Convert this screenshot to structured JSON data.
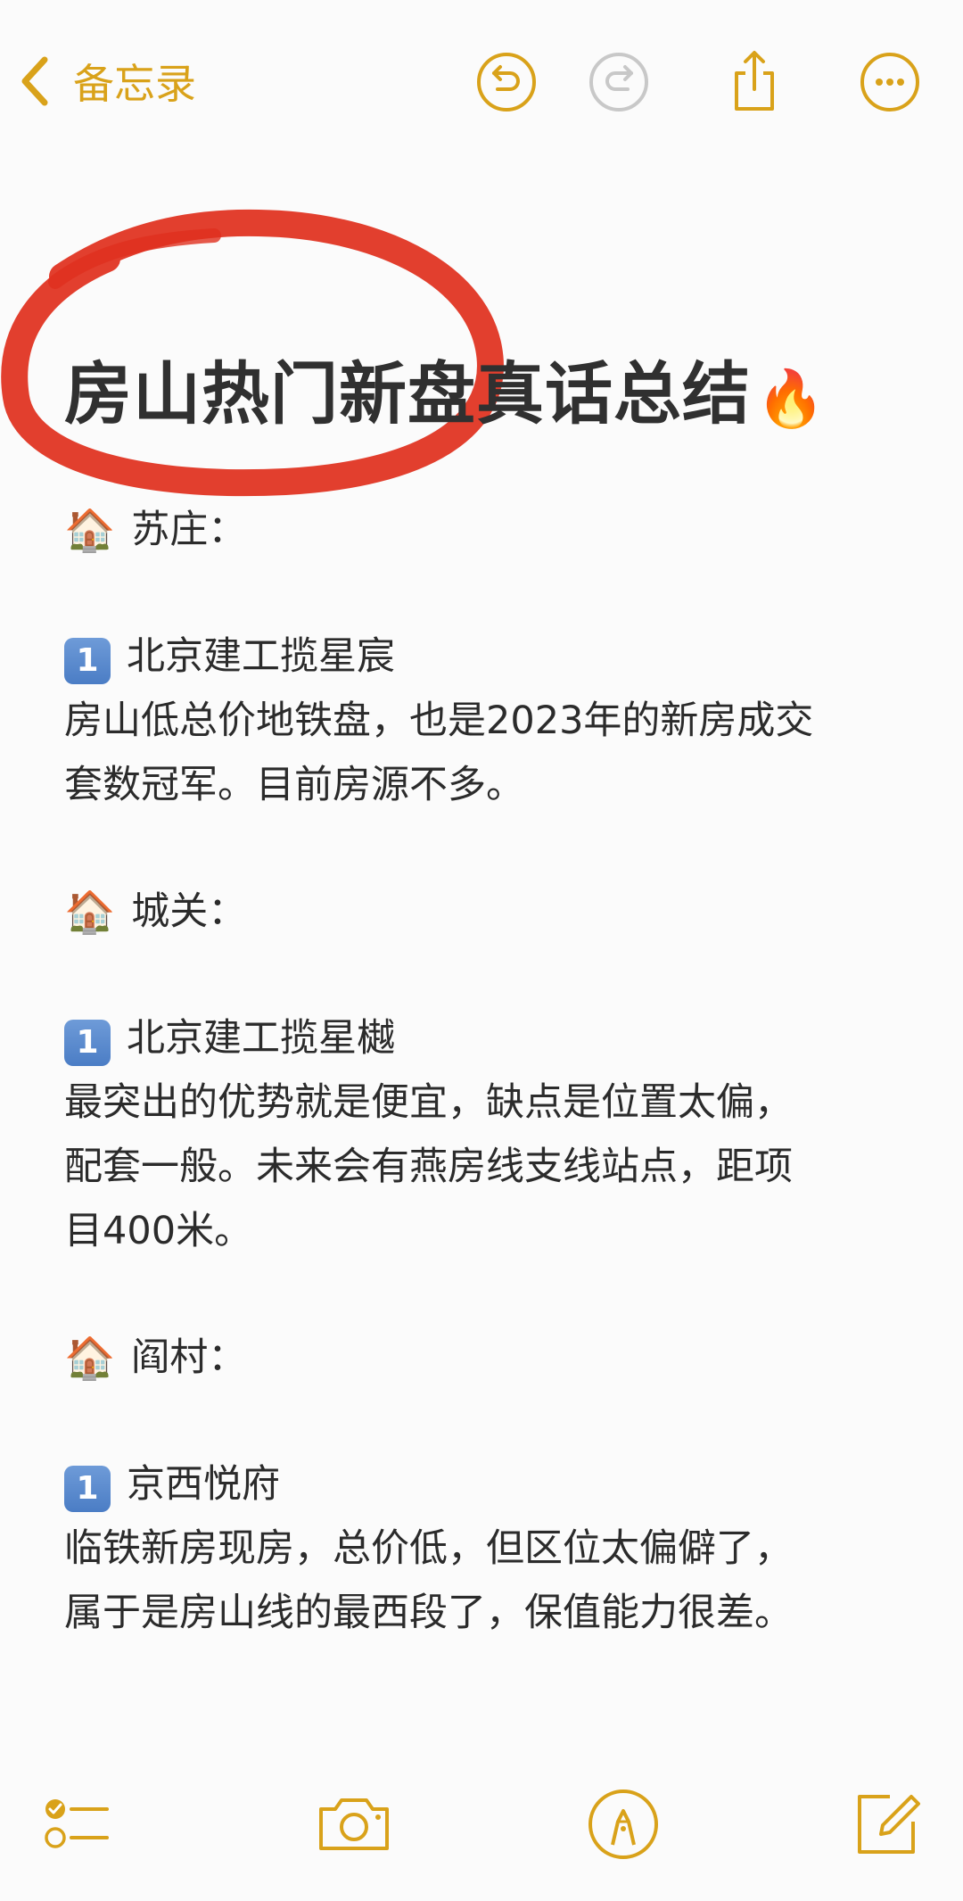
{
  "header": {
    "back_label": "备忘录",
    "icons": [
      "chevron-left-icon",
      "undo-icon",
      "redo-icon",
      "share-icon",
      "more-icon"
    ]
  },
  "note": {
    "title": "房山热门新盘真话总结",
    "title_emoji": "🔥",
    "sections": [
      {
        "area": "苏庄：",
        "items": [
          {
            "number": "1",
            "name": "北京建工揽星宸",
            "lines": [
              "房山低总价地铁盘，也是2023年的新房成交",
              "套数冠军。目前房源不多。"
            ]
          }
        ]
      },
      {
        "area": "城关：",
        "items": [
          {
            "number": "1",
            "name": "北京建工揽星樾",
            "lines": [
              "最突出的优势就是便宜，缺点是位置太偏，",
              "配套一般。未来会有燕房线支线站点，距项",
              "目400米。"
            ]
          }
        ]
      },
      {
        "area": "阎村：",
        "items": [
          {
            "number": "1",
            "name": "京西悦府",
            "lines": [
              "临铁新房现房，总价低，但区位太偏僻了，",
              "属于是房山线的最西段了，保值能力很差。"
            ]
          }
        ]
      }
    ]
  },
  "toolbar": {
    "icons": [
      "checklist-icon",
      "camera-icon",
      "markup-icon",
      "compose-icon"
    ]
  },
  "colors": {
    "accent": "#d9a21a",
    "disabled": "#c8c8c8",
    "highlight_circle": "#e0301e",
    "text": "#2b2b2b"
  }
}
